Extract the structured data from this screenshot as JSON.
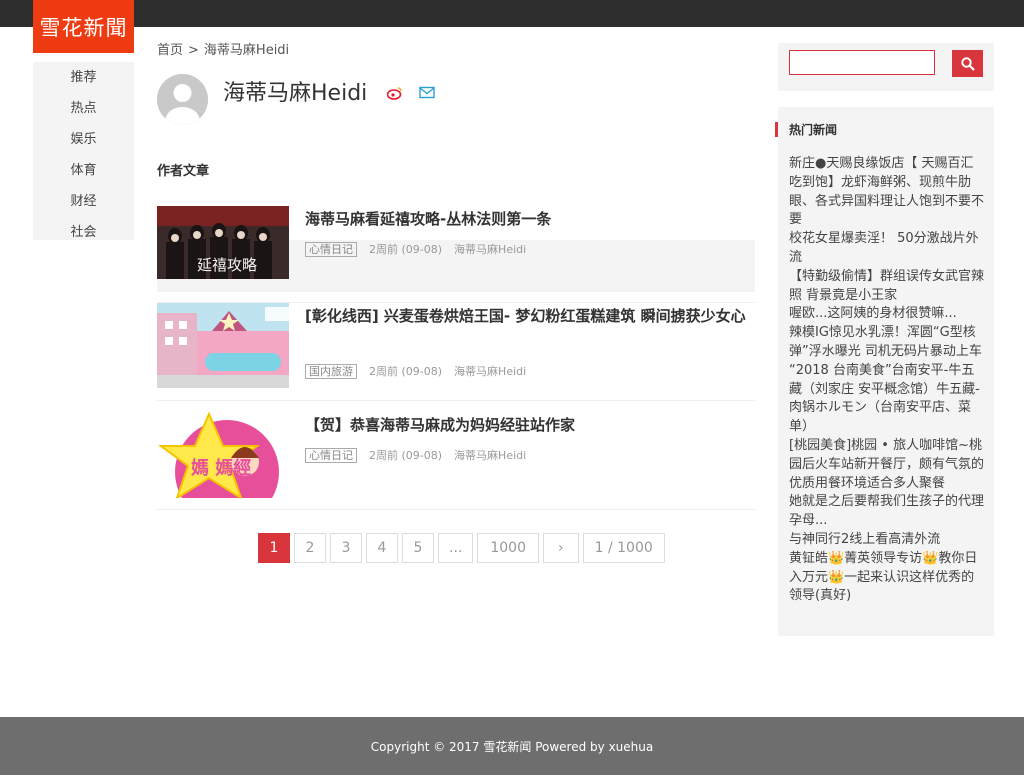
{
  "site": {
    "logo": "雪花新聞"
  },
  "nav": {
    "items": [
      "推荐",
      "热点",
      "娱乐",
      "体育",
      "财经",
      "社会"
    ]
  },
  "breadcrumb": {
    "home": "首页",
    "sep": ">",
    "current": "海蒂马麻Heidi"
  },
  "author": {
    "name": "海蒂马麻Heidi",
    "icons": [
      "weibo-icon",
      "mail-icon"
    ]
  },
  "section": {
    "title": "作者文章"
  },
  "articles": [
    {
      "title": "海蒂马麻看延禧攻略-丛林法则第一条",
      "tag": "心情日记",
      "time": "2周前 (09-08)",
      "author": "海蒂马麻Heidi",
      "thumb_text": "延禧攻略"
    },
    {
      "title": "[彰化线西] 兴麦蛋卷烘焙王国- 梦幻粉红蛋糕建筑 瞬间掳获少女心",
      "tag": "国内旅游",
      "time": "2周前 (09-08)",
      "author": "海蒂马麻Heidi"
    },
    {
      "title": "【贺】恭喜海蒂马麻成为妈妈经驻站作家",
      "tag": "心情日记",
      "time": "2周前 (09-08)",
      "author": "海蒂马麻Heidi",
      "thumb_text": "媽 媽經"
    }
  ],
  "pagination": {
    "pages": [
      "1",
      "2",
      "3",
      "4",
      "5",
      "...",
      "1000",
      "›",
      "1 / 1000"
    ],
    "active": "1"
  },
  "search": {
    "placeholder": ""
  },
  "hot": {
    "title": "热门新闻",
    "items": [
      "新庄●天赐良缘饭店【 天赐百汇吃到饱】龙虾海鲜粥、现煎牛肋眼、各式异国料理让人饱到不要不要",
      "校花女星爆卖淫！ 50分激战片外流",
      "【特勤级偷情】群组误传女武官辣照 背景竟是小王家",
      "喔欧...这阿姨的身材很赞嘛...",
      "辣模IG惊见水乳漂！浑圆“G型核弹”浮水曝光  司机无码片暴动上车",
      "“2018 台南美食”台南安平-牛五藏（刘家庄 安平概念馆）牛五藏-肉锅ホルモン（台南安平店、菜单）",
      "[桃园美食]桃园 • 旅人咖啡馆~桃园后火车站新开餐厅，颇有气氛的优质用餐环境适合多人聚餐",
      "她就是之后要帮我们生孩子的代理孕母...",
      "与神同行2线上看高清外流",
      "黄钲皓👑菁英领导专访👑教你日入万元👑一起来认识这样优秀的领导(真好)"
    ]
  },
  "footer": {
    "text": "Copyright © 2017 雪花新闻 Powered by  xuehua"
  },
  "colors": {
    "accent": "#d9353c",
    "logo_bg": "#ef3b12",
    "topbar": "#2d2d2d",
    "footer": "#6e6e6e"
  }
}
